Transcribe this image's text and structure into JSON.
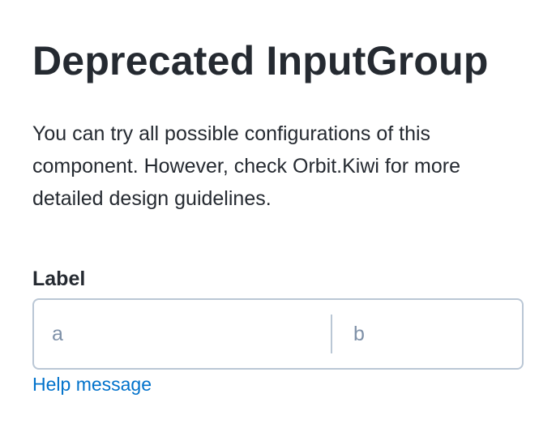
{
  "page": {
    "title": "Deprecated InputGroup",
    "description": "You can try all possible configurations of this component. However, check Orbit.Kiwi for more detailed design guidelines."
  },
  "input_group": {
    "label": "Label",
    "fields": [
      {
        "value": "",
        "placeholder": "a"
      },
      {
        "value": "",
        "placeholder": "b"
      }
    ],
    "help_message": "Help message"
  },
  "colors": {
    "text": "#252a31",
    "border": "#bac7d5",
    "placeholder": "#7f91a8",
    "help": "#0172cb",
    "background": "#ffffff"
  }
}
